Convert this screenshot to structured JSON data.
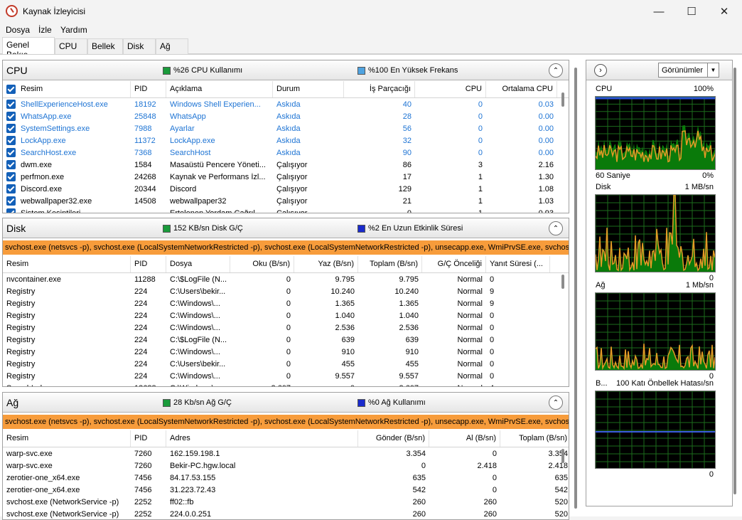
{
  "window": {
    "title": "Kaynak İzleyicisi"
  },
  "menu": [
    "Dosya",
    "İzle",
    "Yardım"
  ],
  "tabs": [
    "Genel Bakış",
    "CPU",
    "Bellek",
    "Disk",
    "Ağ"
  ],
  "cpu": {
    "title": "CPU",
    "legend1": "%26 CPU Kullanımı",
    "legend2": "%100 En Yüksek Frekans",
    "legend1_color": "#1a9b3b",
    "legend2_color": "#4fa3e0",
    "columns": [
      "Resim",
      "PID",
      "Açıklama",
      "Durum",
      "İş Parçacığı",
      "CPU",
      "Ortalama CPU"
    ],
    "rows": [
      [
        "ShellExperienceHost.exe",
        "18192",
        "Windows Shell Experien...",
        "Askıda",
        "40",
        "0",
        "0.03"
      ],
      [
        "WhatsApp.exe",
        "25848",
        "WhatsApp",
        "Askıda",
        "28",
        "0",
        "0.00"
      ],
      [
        "SystemSettings.exe",
        "7988",
        "Ayarlar",
        "Askıda",
        "56",
        "0",
        "0.00"
      ],
      [
        "LockApp.exe",
        "11372",
        "LockApp.exe",
        "Askıda",
        "32",
        "0",
        "0.00"
      ],
      [
        "SearchHost.exe",
        "7368",
        "SearchHost",
        "Askıda",
        "90",
        "0",
        "0.00"
      ],
      [
        "dwm.exe",
        "1584",
        "Masaüstü Pencere Yöneti...",
        "Çalışıyor",
        "86",
        "3",
        "2.16"
      ],
      [
        "perfmon.exe",
        "24268",
        "Kaynak ve Performans İzl...",
        "Çalışıyor",
        "17",
        "1",
        "1.30"
      ],
      [
        "Discord.exe",
        "20344",
        "Discord",
        "Çalışıyor",
        "129",
        "1",
        "1.08"
      ],
      [
        "webwallpaper32.exe",
        "14508",
        "webwallpaper32",
        "Çalışıyor",
        "21",
        "1",
        "1.03"
      ],
      [
        "Sistem Kesintileri",
        "-",
        "Ertelenen Yordam Çağrıl...",
        "Çalışıyor",
        "0",
        "1",
        "0.93"
      ]
    ]
  },
  "disk": {
    "title": "Disk",
    "legend1": "152 KB/sn Disk G/Ç",
    "legend2": "%2 En Uzun Etkinlik Süresi",
    "legend1_color": "#1a9b3b",
    "legend2_color": "#1a2bcc",
    "filter": "svchost.exe (netsvcs -p), svchost.exe (LocalSystemNetworkRestricted -p), svchost.exe (LocalSystemNetworkRestricted -p), unsecapp.exe, WmiPrvSE.exe, svchost.exe",
    "columns": [
      "Resim",
      "PID",
      "Dosya",
      "Oku (B/sn)",
      "Yaz (B/sn)",
      "Toplam (B/sn)",
      "G/Ç Önceliği",
      "Yanıt Süresi (..."
    ],
    "rows": [
      [
        "nvcontainer.exe",
        "11288",
        "C:\\$LogFile (N...",
        "0",
        "9.795",
        "9.795",
        "Normal",
        "0"
      ],
      [
        "Registry",
        "224",
        "C:\\Users\\bekir...",
        "0",
        "10.240",
        "10.240",
        "Normal",
        "9"
      ],
      [
        "Registry",
        "224",
        "C:\\Windows\\...",
        "0",
        "1.365",
        "1.365",
        "Normal",
        "9"
      ],
      [
        "Registry",
        "224",
        "C:\\Windows\\...",
        "0",
        "1.040",
        "1.040",
        "Normal",
        "0"
      ],
      [
        "Registry",
        "224",
        "C:\\Windows\\...",
        "0",
        "2.536",
        "2.536",
        "Normal",
        "0"
      ],
      [
        "Registry",
        "224",
        "C:\\$LogFile (N...",
        "0",
        "639",
        "639",
        "Normal",
        "0"
      ],
      [
        "Registry",
        "224",
        "C:\\Windows\\...",
        "0",
        "910",
        "910",
        "Normal",
        "0"
      ],
      [
        "Registry",
        "224",
        "C:\\Users\\bekir...",
        "0",
        "455",
        "455",
        "Normal",
        "0"
      ],
      [
        "Registry",
        "224",
        "C:\\Windows\\...",
        "0",
        "9.557",
        "9.557",
        "Normal",
        "0"
      ],
      [
        "SearchIndexer.exe",
        "13688",
        "C:\\Windows\\...",
        "2.607",
        "0",
        "2.607",
        "Normal",
        "4"
      ]
    ]
  },
  "net": {
    "title": "Ağ",
    "legend1": "28 Kb/sn Ağ G/Ç",
    "legend2": "%0 Ağ Kullanımı",
    "legend1_color": "#1a9b3b",
    "legend2_color": "#1a2bcc",
    "filter": "svchost.exe (netsvcs -p), svchost.exe (LocalSystemNetworkRestricted -p), svchost.exe (LocalSystemNetworkRestricted -p), unsecapp.exe, WmiPrvSE.exe, svchost.exe",
    "columns": [
      "Resim",
      "PID",
      "Adres",
      "Gönder (B/sn)",
      "Al (B/sn)",
      "Toplam (B/sn)"
    ],
    "rows": [
      [
        "warp-svc.exe",
        "7260",
        "162.159.198.1",
        "3.354",
        "0",
        "3.354"
      ],
      [
        "warp-svc.exe",
        "7260",
        "Bekir-PC.hgw.local",
        "0",
        "2.418",
        "2.418"
      ],
      [
        "zerotier-one_x64.exe",
        "7456",
        "84.17.53.155",
        "635",
        "0",
        "635"
      ],
      [
        "zerotier-one_x64.exe",
        "7456",
        "31.223.72.43",
        "542",
        "0",
        "542"
      ],
      [
        "svchost.exe (NetworkService -p)",
        "2252",
        "ff02::fb",
        "260",
        "260",
        "520"
      ],
      [
        "svchost.exe (NetworkService -p)",
        "2252",
        "224.0.0.251",
        "260",
        "260",
        "520"
      ]
    ]
  },
  "right": {
    "views": "Görünümler",
    "graphs": [
      {
        "title": "CPU",
        "max": "100%",
        "foot_left": "60 Saniye",
        "foot_right": "0%"
      },
      {
        "title": "Disk",
        "max": "1 MB/sn",
        "foot_left": "",
        "foot_right": "0"
      },
      {
        "title": "Ağ",
        "max": "1 Mb/sn",
        "foot_left": "",
        "foot_right": "0"
      },
      {
        "title": "B...",
        "max": "100 Katı Önbellek Hatası/sn",
        "foot_left": "",
        "foot_right": "0"
      }
    ]
  }
}
